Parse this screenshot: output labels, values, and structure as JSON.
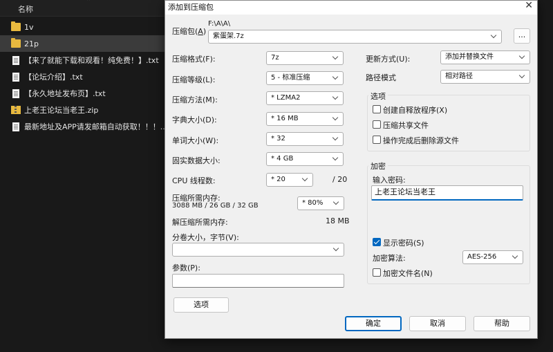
{
  "explorer": {
    "column_header": "名称",
    "files": [
      {
        "name": "1v",
        "type": "folder"
      },
      {
        "name": "21p",
        "type": "folder",
        "selected": true
      },
      {
        "name": "【来了就能下载和观看！纯免费！】.txt",
        "type": "txt"
      },
      {
        "name": "【论坛介绍】.txt",
        "type": "txt"
      },
      {
        "name": "【永久地址发布页】.txt",
        "type": "txt"
      },
      {
        "name": "上老王论坛当老王.zip",
        "type": "zip"
      },
      {
        "name": "最新地址及APP请发邮箱自动获取！！！....",
        "type": "txt"
      }
    ]
  },
  "dialog": {
    "title": "添加到压缩包",
    "archive_label": "压缩包(",
    "archive_label_key": "A",
    "archive_label_end": ")",
    "archive_path": "F:\\A\\A\\",
    "archive_name": "紫蛋架.7z",
    "browse_label": "...",
    "format_label": "压缩格式(F):",
    "format_value": "7z",
    "level_label": "压缩等级(L):",
    "level_value": "5 - 标准压缩",
    "method_label": "压缩方法(M):",
    "method_value": "* LZMA2",
    "dict_label": "字典大小(D):",
    "dict_value": "* 16 MB",
    "word_label": "单词大小(W):",
    "word_value": "* 32",
    "solid_label": "固实数据大小:",
    "solid_value": "* 4 GB",
    "threads_label": "CPU 线程数:",
    "threads_value": "* 20",
    "threads_max": "/ 20",
    "mem_comp_label": "压缩所需内存:",
    "mem_comp_value": "3088 MB / 26 GB / 32 GB",
    "mem_percent": "* 80%",
    "mem_decomp_label": "解压缩所需内存:",
    "mem_decomp_value": "18 MB",
    "split_label": "分卷大小，字节(V):",
    "split_value": "",
    "params_label": "参数(P):",
    "params_value": "",
    "options_button": "选项",
    "update_label": "更新方式(U):",
    "update_value": "添加并替换文件",
    "path_label": "路径模式",
    "path_value": "相对路径",
    "options_group": "选项",
    "opt_sfx": "创建自释放程序(X)",
    "opt_shared": "压缩共享文件",
    "opt_delete": "操作完成后删除源文件",
    "encryption_group": "加密",
    "password_label": "输入密码:",
    "password_value": "上老王论坛当老王",
    "show_password": "显示密码(S)",
    "enc_method_label": "加密算法:",
    "enc_method_value": "AES-256",
    "encrypt_names": "加密文件名(N)",
    "ok_button": "确定",
    "cancel_button": "取消",
    "help_button": "帮助"
  }
}
